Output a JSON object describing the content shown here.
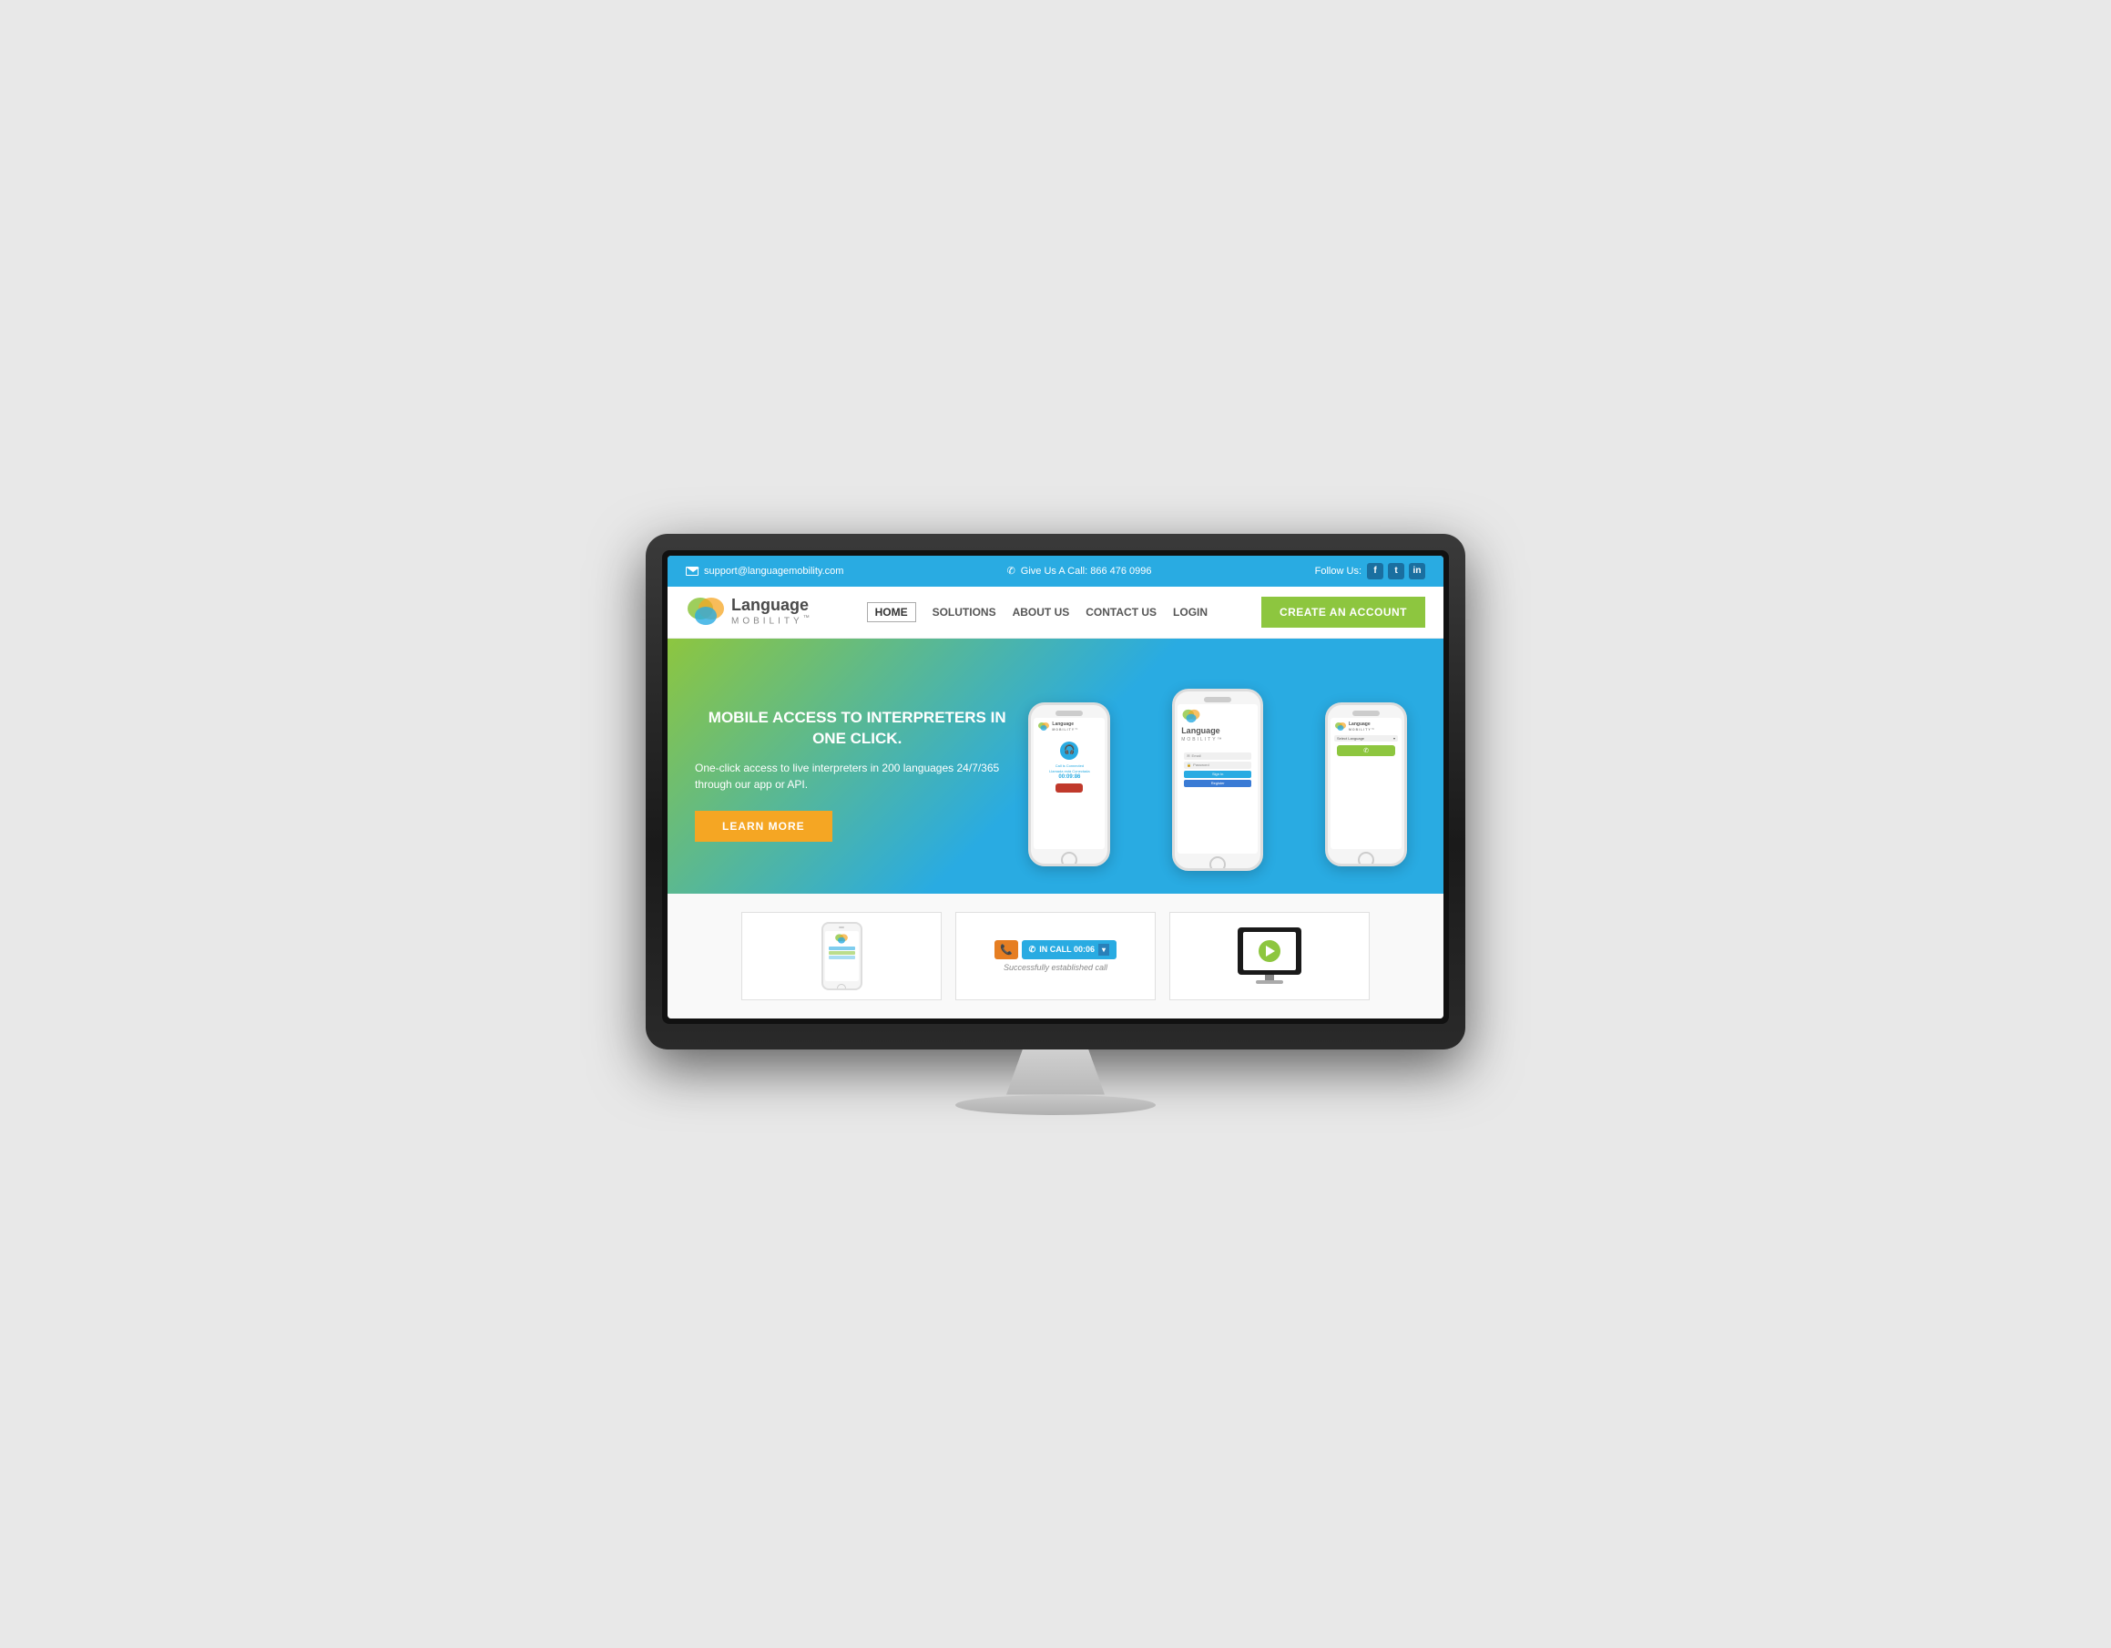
{
  "topbar": {
    "email": "support@languagemobility.com",
    "phone_label": "Give Us A Call: 866 476 0996",
    "follow_us": "Follow Us:",
    "social": [
      "f",
      "t",
      "in"
    ]
  },
  "nav": {
    "logo_language": "Language",
    "logo_mobility": "MOBILITY",
    "logo_tm": "™",
    "links": [
      "HOME",
      "SOLUTIONS",
      "ABOUT US",
      "CONTACT US",
      "LOGIN"
    ],
    "cta_button": "CREATE AN ACCOUNT"
  },
  "hero": {
    "title": "MOBILE ACCESS TO INTERPRETERS IN ONE CLICK.",
    "subtitle": "One-click access to live interpreters in 200 languages 24/7/365 through our app or API.",
    "learn_more": "LEARN MORE"
  },
  "phone_screens": {
    "left": {
      "call_text1": "Call is Connected",
      "call_text2": "Llamada está Conectada",
      "timer": "00:09:86"
    },
    "center": {
      "email_placeholder": "Email",
      "password_placeholder": "Password",
      "signin_label": "Sign In",
      "register_label": "Register"
    },
    "right": {
      "select_language": "Select Language"
    }
  },
  "features": {
    "card1_aria": "Mobile app screenshot",
    "card2_status": "IN  CALL  00:06",
    "card2_success": "Successfully established call",
    "card3_aria": "Video demo"
  }
}
